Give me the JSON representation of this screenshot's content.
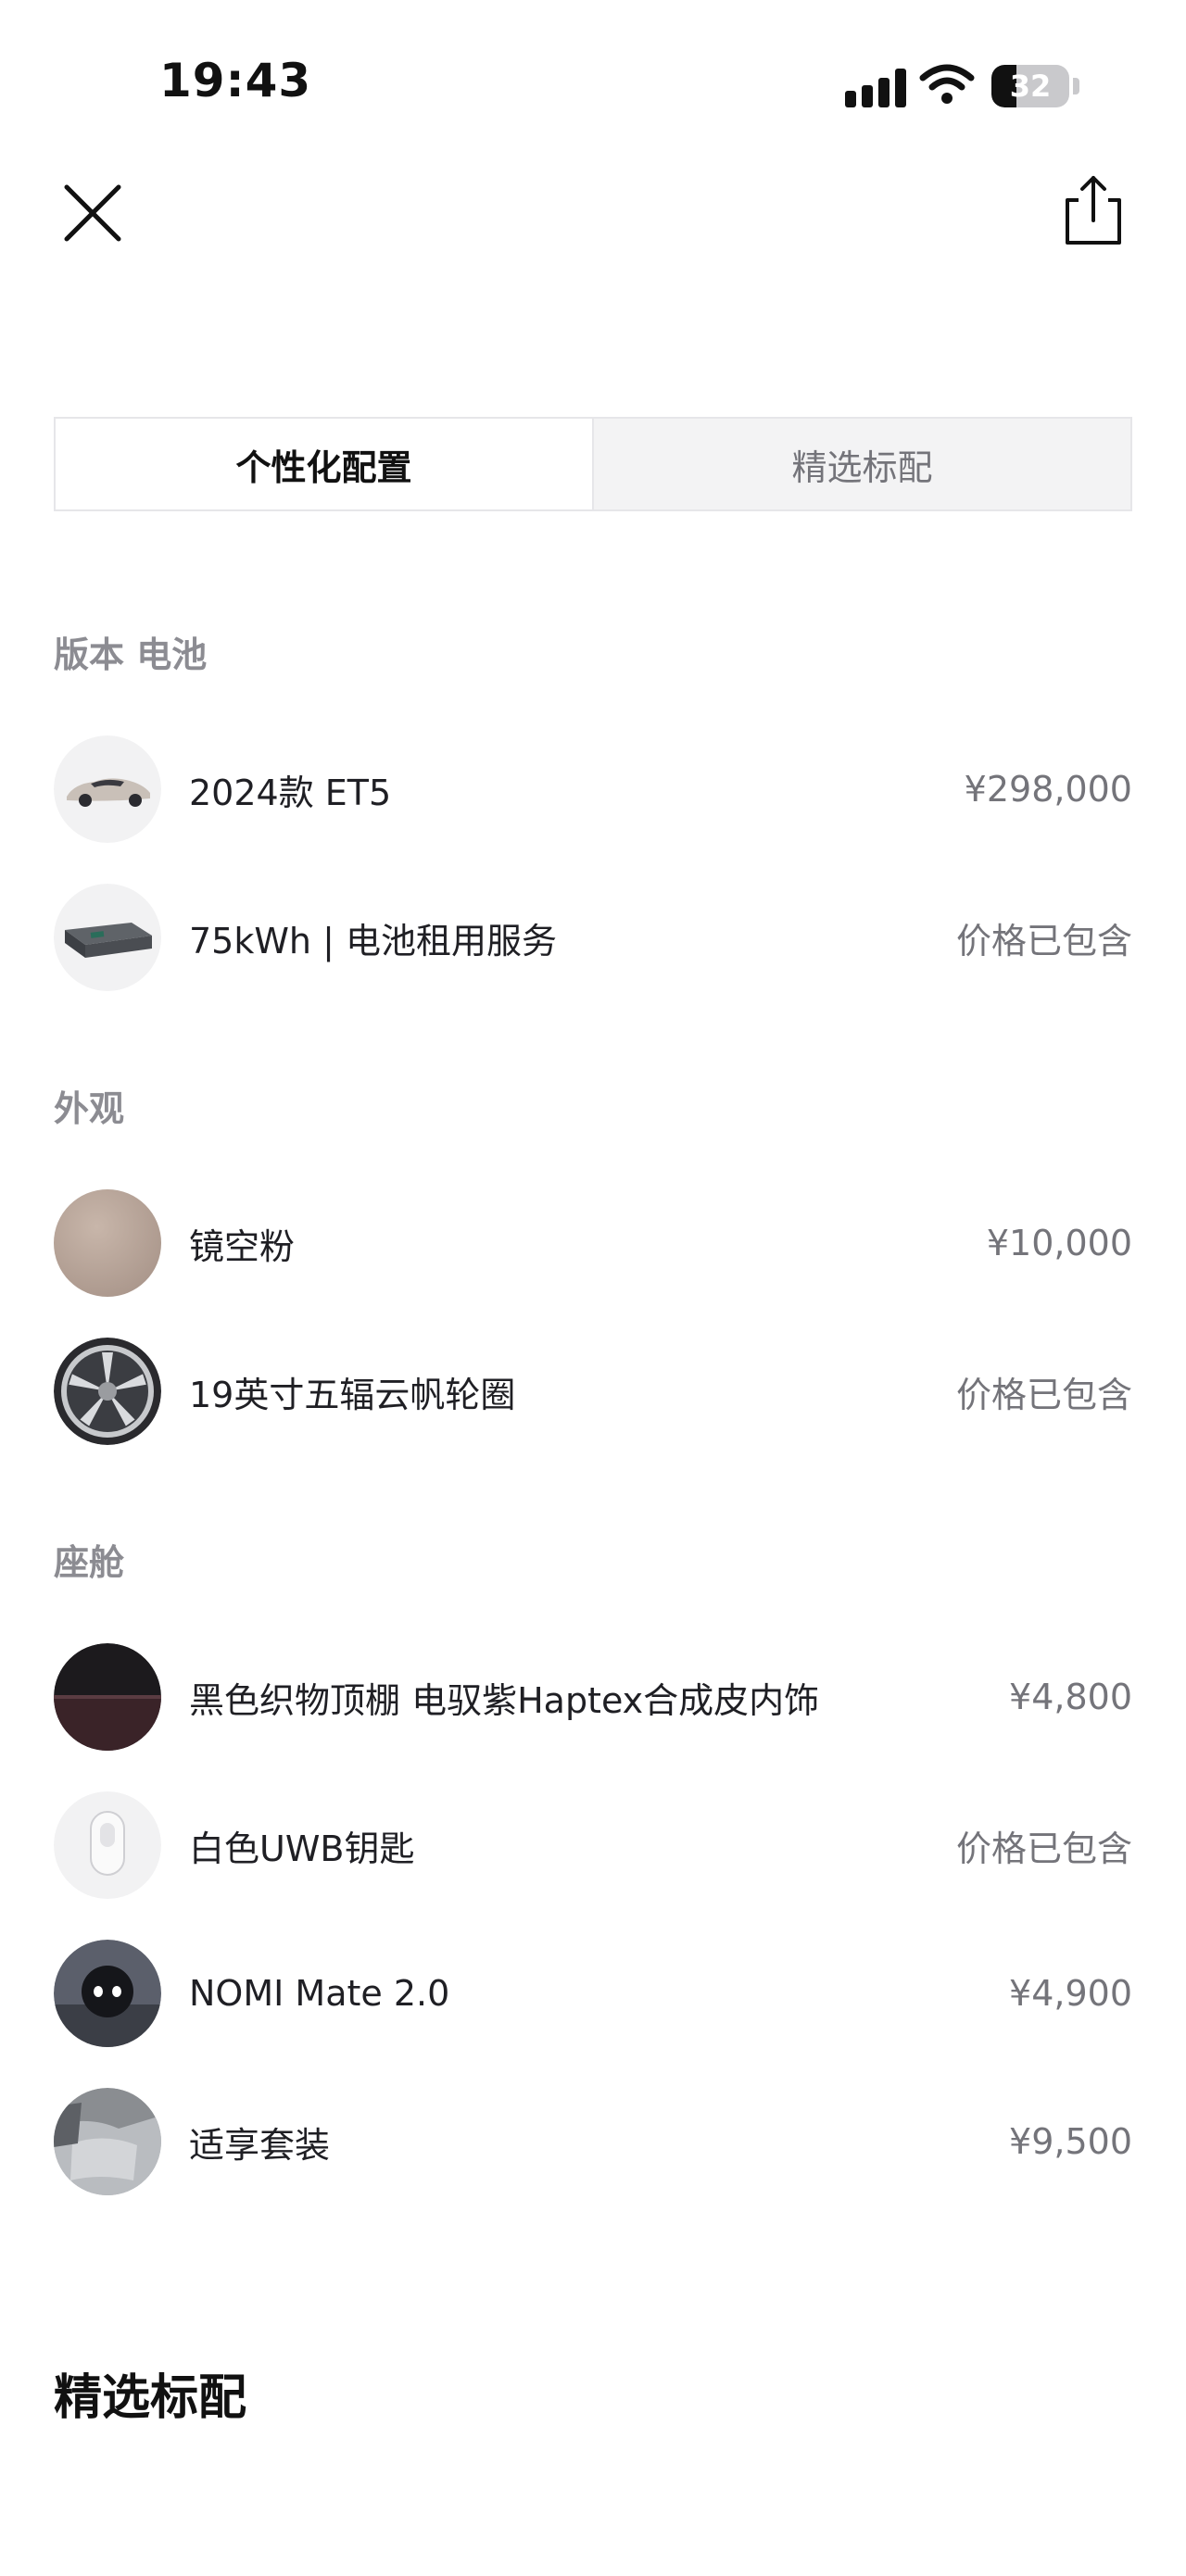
{
  "status_bar": {
    "time": "19:43",
    "battery_level": "32"
  },
  "tabs": [
    {
      "label": "个性化配置",
      "active": true
    },
    {
      "label": "精选标配",
      "active": false
    }
  ],
  "sections": [
    {
      "title": "版本 电池",
      "items": [
        {
          "label": "2024款 ET5",
          "price": "¥298,000",
          "thumb": "car-side-image"
        },
        {
          "label": "75kWh | 电池租用服务",
          "price": "价格已包含",
          "thumb": "battery-pack-image"
        }
      ]
    },
    {
      "title": "外观",
      "items": [
        {
          "label": "镜空粉",
          "price": "¥10,000",
          "thumb": "paint-color-swatch",
          "color": "#b59f92"
        },
        {
          "label": "19英寸五辐云帆轮圈",
          "price": "价格已包含",
          "thumb": "wheel-rim-image"
        }
      ]
    },
    {
      "title": "座舱",
      "items": [
        {
          "label": "黑色织物顶棚 电驭紫Haptex合成皮内饰",
          "price": "¥4,800",
          "thumb": "interior-fabric-swatch"
        },
        {
          "label": "白色UWB钥匙",
          "price": "价格已包含",
          "thumb": "uwb-key-image"
        },
        {
          "label": "NOMI Mate 2.0",
          "price": "¥4,900",
          "thumb": "nomi-robot-image"
        },
        {
          "label": "适享套装",
          "price": "¥9,500",
          "thumb": "comfort-seat-image"
        }
      ]
    }
  ],
  "bottom_heading": "精选标配"
}
